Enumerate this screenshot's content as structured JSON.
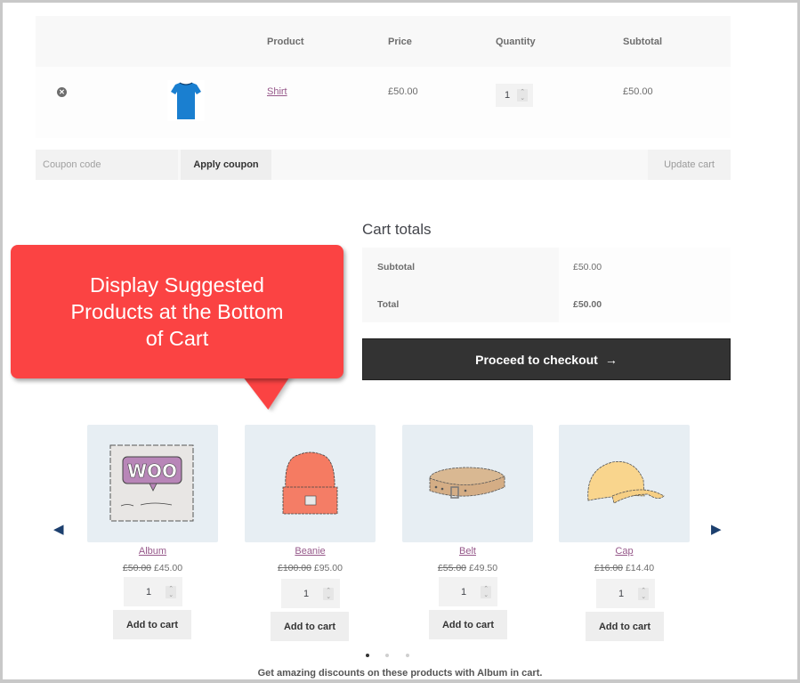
{
  "cart_table": {
    "headers": {
      "product": "Product",
      "price": "Price",
      "quantity": "Quantity",
      "subtotal": "Subtotal"
    },
    "rows": [
      {
        "remove_icon": "remove-circle-icon",
        "image": "blue-tshirt",
        "name": "Shirt",
        "price": "£50.00",
        "quantity": "1",
        "subtotal": "£50.00"
      }
    ]
  },
  "actions": {
    "coupon_placeholder": "Coupon code",
    "apply_coupon": "Apply coupon",
    "update_cart": "Update cart"
  },
  "cart_totals": {
    "title": "Cart totals",
    "rows": [
      {
        "label": "Subtotal",
        "value": "£50.00"
      },
      {
        "label": "Total",
        "value": "£50.00"
      }
    ],
    "checkout_label": "Proceed to checkout",
    "checkout_arrow": "→"
  },
  "callout": {
    "line1": "Display Suggested",
    "line2": "Products at the Bottom",
    "line3": "of Cart",
    "color": "#fb4343"
  },
  "suggested": {
    "prev_icon": "◀",
    "next_icon": "▶",
    "products": [
      {
        "name": "Album",
        "old_price": "£50.00",
        "price": "£45.00",
        "quantity": "1",
        "button": "Add to cart"
      },
      {
        "name": "Beanie",
        "old_price": "£100.00",
        "price": "£95.00",
        "quantity": "1",
        "button": "Add to cart"
      },
      {
        "name": "Belt",
        "old_price": "£55.00",
        "price": "£49.50",
        "quantity": "1",
        "button": "Add to cart"
      },
      {
        "name": "Cap",
        "old_price": "£16.00",
        "price": "£14.40",
        "quantity": "1",
        "button": "Add to cart"
      }
    ],
    "pagination": {
      "pages": 3,
      "active": 1
    },
    "note": "Get amazing discounts on these products with Album in cart."
  },
  "colors": {
    "link": "#96588a",
    "checkout_bg": "#333333",
    "arrow": "#1c3f6e",
    "image_bg": "#e7eef3"
  }
}
